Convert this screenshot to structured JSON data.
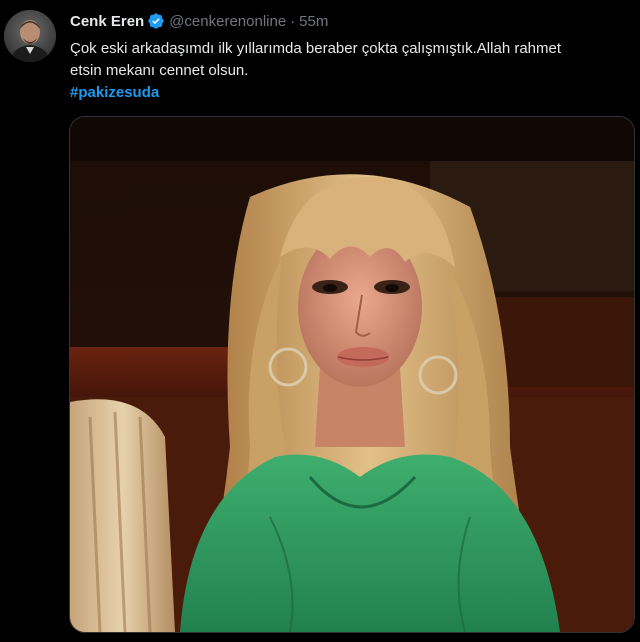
{
  "tweet": {
    "author": {
      "display_name": "Cenk Eren",
      "handle": "@cenkerenonline",
      "verified": true,
      "avatar_icon": "person-avatar-icon"
    },
    "separator": "·",
    "timestamp": "55m",
    "text_line1": "Çok eski arkadaşımdı ilk yıllarımda beraber çokta çalışmıştık.Allah rahmet",
    "text_line2": "etsin mekanı cennet olsun.",
    "hashtag": "#pakizesuda",
    "media": {
      "type": "photo",
      "icon": "photo-image"
    }
  },
  "colors": {
    "background": "#000000",
    "text_primary": "#e7e9ea",
    "text_secondary": "#71767b",
    "accent": "#1d9bf0",
    "border": "#2f3336"
  }
}
